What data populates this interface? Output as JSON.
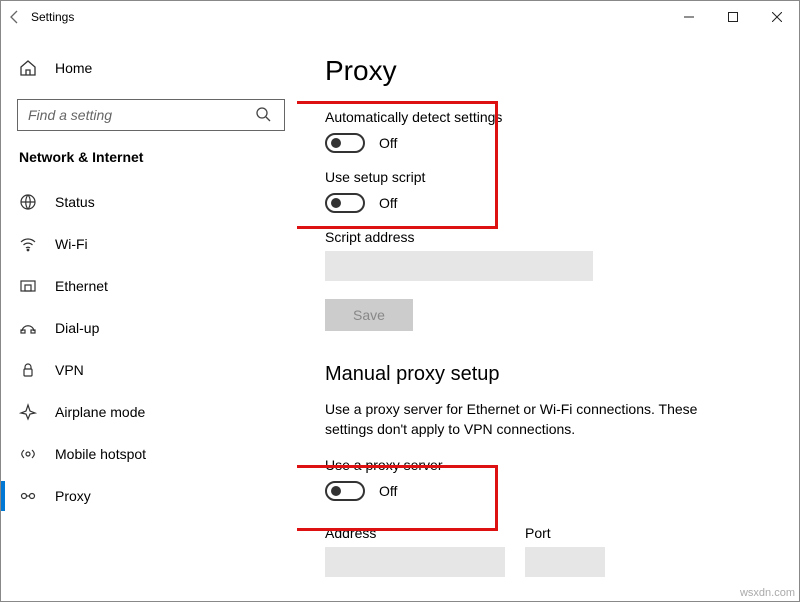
{
  "window": {
    "title": "Settings"
  },
  "sidebar": {
    "home": "Home",
    "search_placeholder": "Find a setting",
    "category": "Network & Internet",
    "items": [
      {
        "id": "status",
        "label": "Status",
        "icon": "status-icon"
      },
      {
        "id": "wifi",
        "label": "Wi-Fi",
        "icon": "wifi-icon"
      },
      {
        "id": "ethernet",
        "label": "Ethernet",
        "icon": "ethernet-icon"
      },
      {
        "id": "dialup",
        "label": "Dial-up",
        "icon": "dialup-icon"
      },
      {
        "id": "vpn",
        "label": "VPN",
        "icon": "vpn-icon"
      },
      {
        "id": "airplane",
        "label": "Airplane mode",
        "icon": "airplane-icon"
      },
      {
        "id": "hotspot",
        "label": "Mobile hotspot",
        "icon": "hotspot-icon"
      },
      {
        "id": "proxy",
        "label": "Proxy",
        "icon": "proxy-icon"
      }
    ]
  },
  "page": {
    "title": "Proxy",
    "auto_detect_label": "Automatically detect settings",
    "auto_detect_value": "Off",
    "setup_script_label": "Use setup script",
    "setup_script_value": "Off",
    "script_address_label": "Script address",
    "save_label": "Save",
    "manual_title": "Manual proxy setup",
    "manual_desc": "Use a proxy server for Ethernet or Wi-Fi connections. These settings don't apply to VPN connections.",
    "use_proxy_label": "Use a proxy server",
    "use_proxy_value": "Off",
    "address_label": "Address",
    "port_label": "Port"
  },
  "watermark": "wsxdn.com"
}
